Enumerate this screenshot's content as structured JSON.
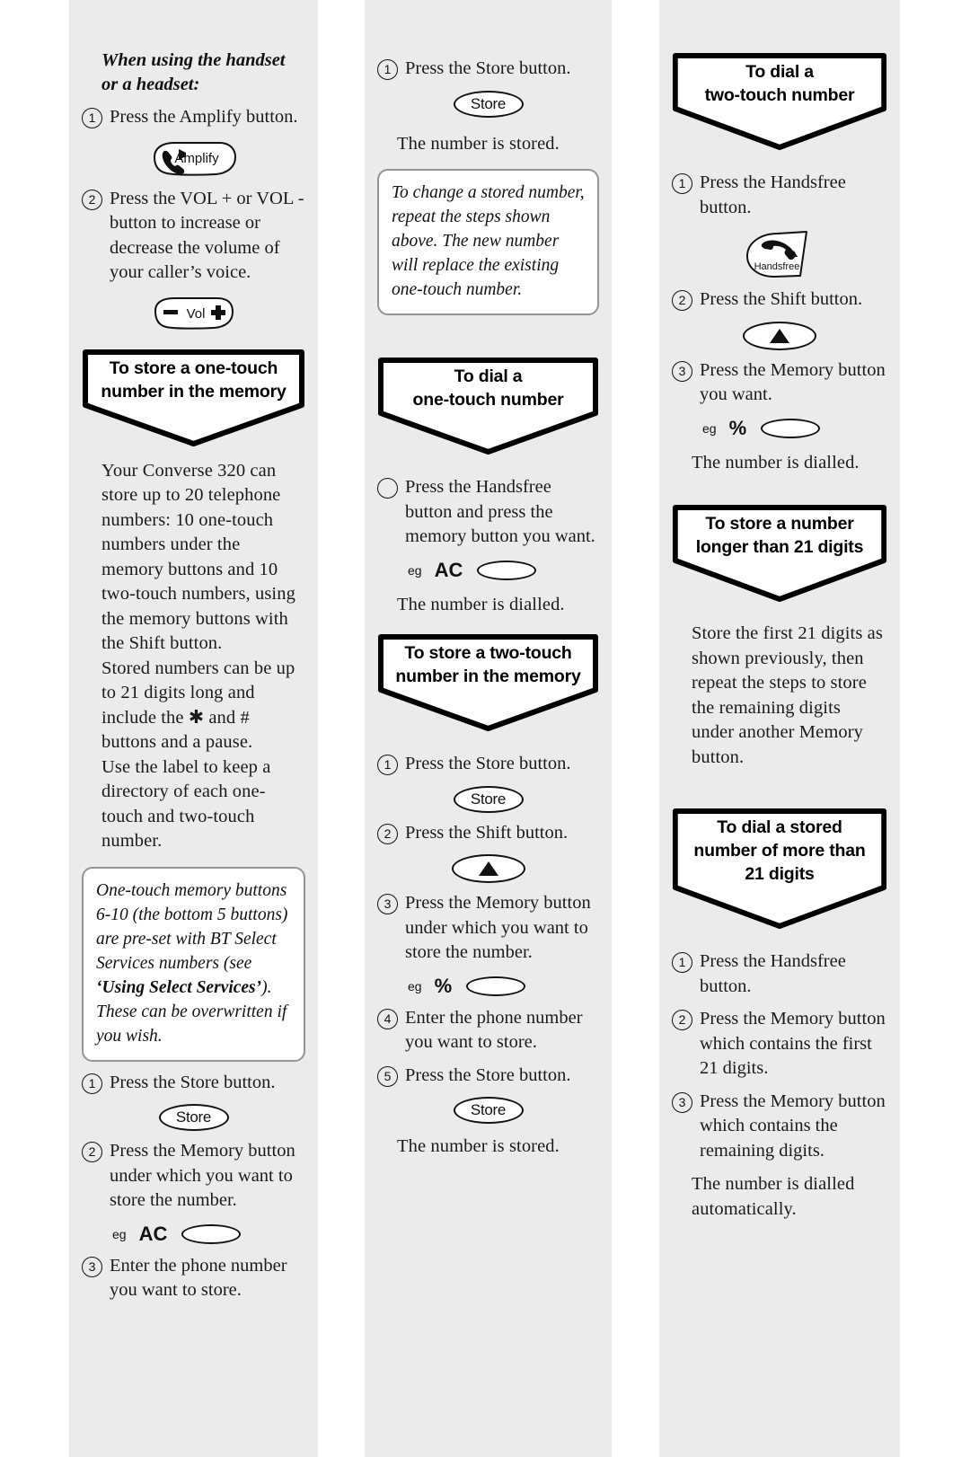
{
  "col1": {
    "handset_heading": "When using the handset or a headset:",
    "step1": {
      "num": "1",
      "text": "Press the Amplify button."
    },
    "amplify_key": {
      "label": "Amplify",
      "icon": "handset-speaker-icon"
    },
    "step2": {
      "num": "2",
      "text": "Press the VOL + or VOL - button to increase or decrease the volume of your caller’s voice."
    },
    "vol_key": {
      "minus": "–",
      "label": "Vol",
      "plus": "+"
    },
    "banner": {
      "line1": "To store a one-touch",
      "line2": "number in the memory"
    },
    "body": "Your Converse 320 can store up to 20 telephone numbers:  10 one-touch numbers under the memory buttons and 10 two-touch numbers, using the memory buttons with the Shift button.",
    "body2": "Stored numbers can be up to 21 digits long and include the ✱ and # buttons and a pause.",
    "body3": "Use the label to keep a directory of each one-touch and two-touch number.",
    "note": {
      "part1": "One-touch memory buttons 6-10 (the bottom 5 buttons) are pre-set with BT Select Services numbers (see ",
      "bold": "‘Using Select Services’",
      "part2": "). These can be overwritten if you wish."
    },
    "s1": {
      "num": "1",
      "text": "Press the Store button."
    },
    "store_key": "Store",
    "s2": {
      "num": "2",
      "text": "Press the Memory button under which you want to store the number."
    },
    "eg1": {
      "eg": "eg",
      "symbol": "AC"
    },
    "s3": {
      "num": "3",
      "text": "Enter the phone number you want to store."
    }
  },
  "col2": {
    "s1": {
      "num": "1",
      "text": "Press the Store button."
    },
    "store_key": "Store",
    "stored_msg": "The number is stored.",
    "note": "To change a stored number, repeat the steps shown above. The new number will replace the existing one-touch number.",
    "banner1": {
      "line1": "To dial a",
      "line2": "one-touch number"
    },
    "d1": {
      "num": "",
      "text": "Press the Handsfree button and press the memory button you want."
    },
    "eg1": {
      "eg": "eg",
      "symbol": "AC"
    },
    "dialled_msg": "The number is dialled.",
    "banner2": {
      "line1": "To store a two-touch",
      "line2": "number in the memory"
    },
    "t1": {
      "num": "1",
      "text": "Press the Store button."
    },
    "t2": {
      "num": "2",
      "text": "Press the Shift button."
    },
    "t3": {
      "num": "3",
      "text": "Press the Memory button under which you want to store the number."
    },
    "eg2": {
      "eg": "eg",
      "symbol": "%"
    },
    "t4": {
      "num": "4",
      "text": "Enter the phone number you want to store."
    },
    "t5": {
      "num": "5",
      "text": "Press the Store button."
    },
    "stored_msg2": "The number is stored."
  },
  "col3": {
    "banner1": {
      "line1": "To dial a",
      "line2": "two-touch number"
    },
    "a1": {
      "num": "1",
      "text": "Press the Handsfree button."
    },
    "handsfree_key": {
      "label": "Handsfree",
      "icon": "handset-icon"
    },
    "a2": {
      "num": "2",
      "text": "Press the Shift button."
    },
    "a3": {
      "num": "3",
      "text": "Press the Memory button you want."
    },
    "eg1": {
      "eg": "eg",
      "symbol": "%"
    },
    "dialled_msg": "The number is dialled.",
    "banner2": {
      "line1": "To store a number",
      "line2": "longer than 21 digits"
    },
    "body": "Store the first 21 digits as shown previously, then repeat the steps to store the remaining digits under another Memory button.",
    "banner3": {
      "line1": "To dial a stored",
      "line2": "number of more than",
      "line3": "21 digits"
    },
    "b1": {
      "num": "1",
      "text": "Press the Handsfree button."
    },
    "b2": {
      "num": "2",
      "text": "Press the Memory button which contains the first 21 digits."
    },
    "b3": {
      "num": "3",
      "text": "Press the Memory button which contains the remaining digits."
    },
    "final_msg": "The number is dialled automatically."
  },
  "colors": {
    "column_bg": "#ebebeb",
    "page_bg": "#ffffff",
    "ink": "#1a1a1a",
    "note_border": "#8c969c"
  }
}
